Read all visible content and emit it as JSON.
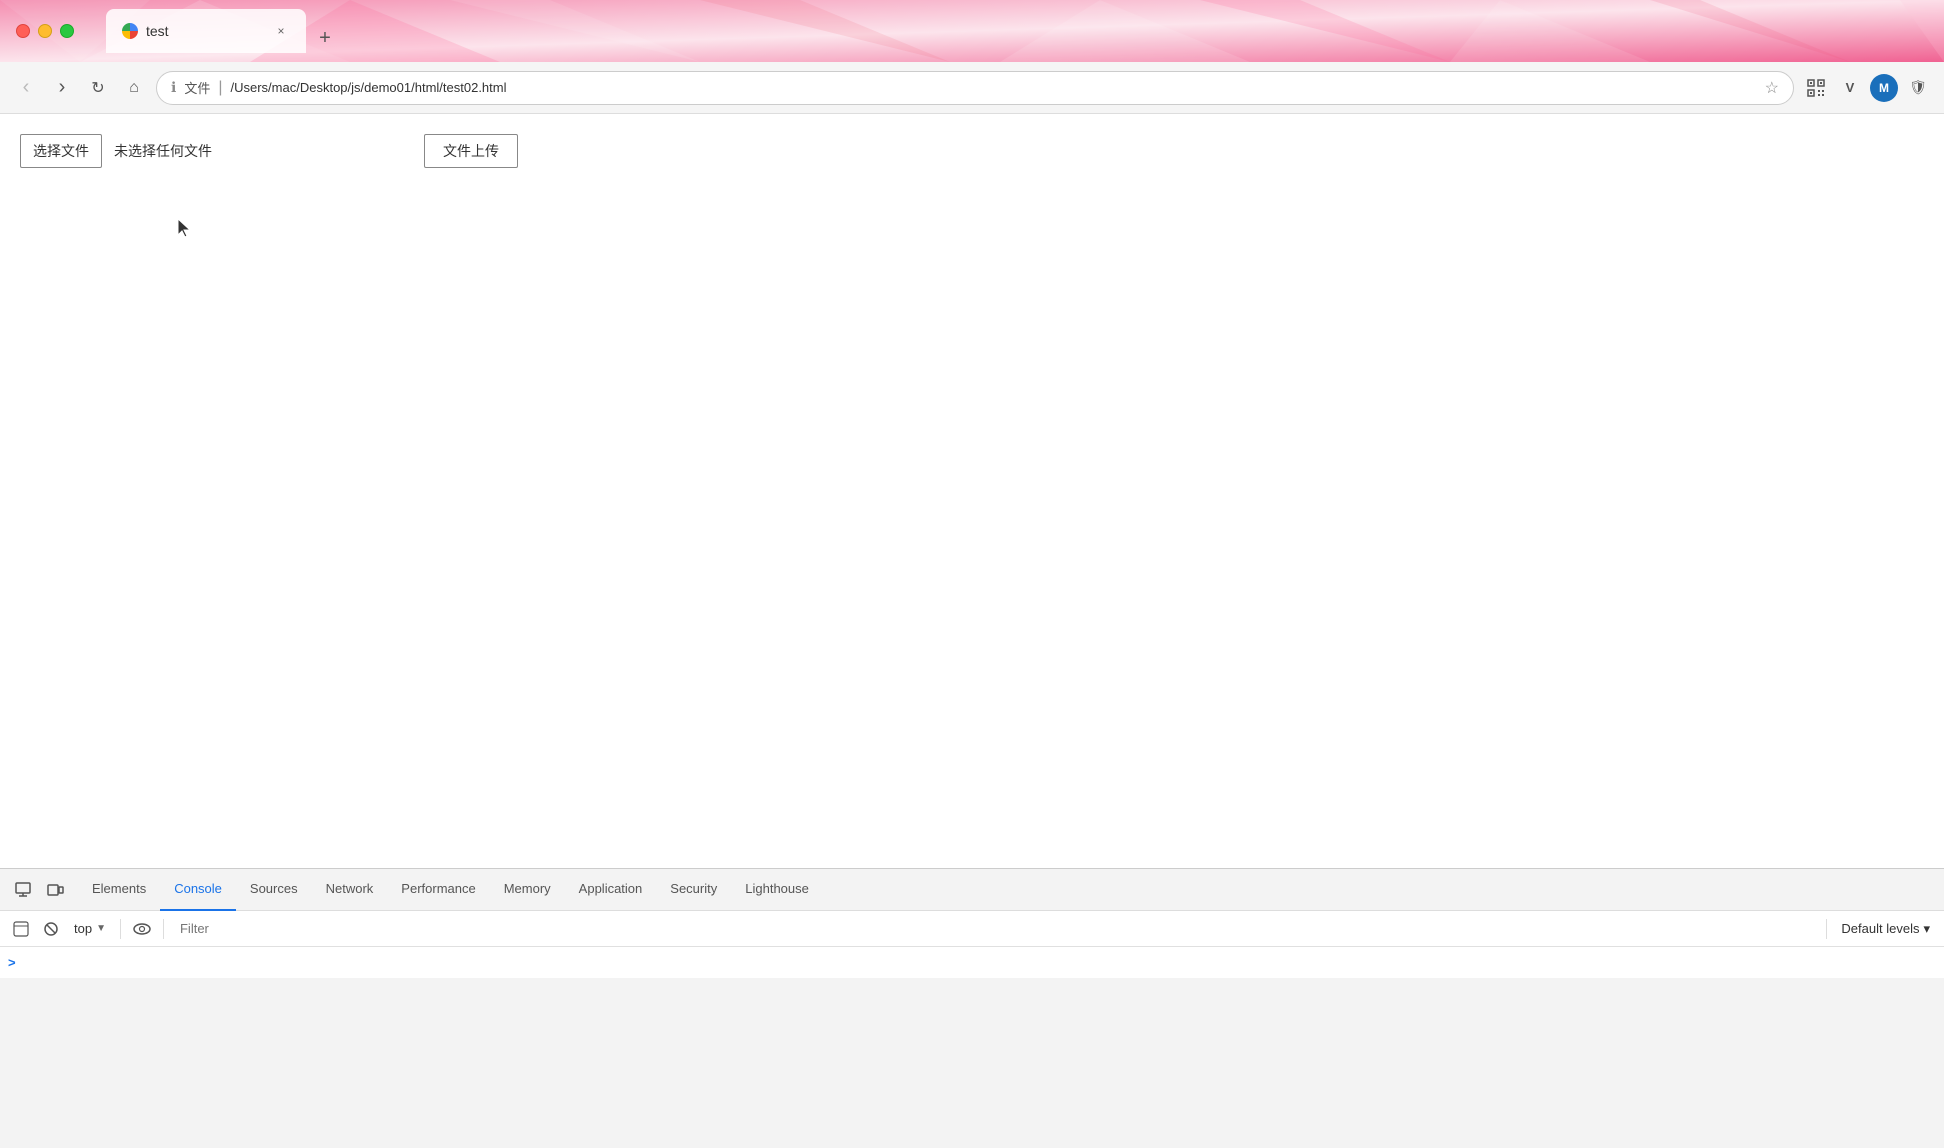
{
  "browser": {
    "traffic_lights": {
      "close_label": "",
      "min_label": "",
      "max_label": ""
    },
    "tab": {
      "title": "test",
      "close_label": "×"
    },
    "new_tab_label": "+",
    "nav": {
      "back_label": "‹",
      "forward_label": "›",
      "reload_label": "↻",
      "home_label": "⌂",
      "info_label": "ℹ",
      "file_label": "文件",
      "separator": "|",
      "url": "/Users/mac/Desktop/js/demo01/html/test02.html",
      "star_label": "☆",
      "qr_label": "▦",
      "extension1_label": "V",
      "extension2_label": "M",
      "extension3_label": "🛡"
    },
    "page": {
      "choose_file_btn": "选择文件",
      "file_status": "未选择任何文件",
      "upload_btn": "文件上传"
    },
    "devtools": {
      "icon1_label": "⬚",
      "icon2_label": "⧉",
      "tabs": [
        {
          "id": "elements",
          "label": "Elements",
          "active": false
        },
        {
          "id": "console",
          "label": "Console",
          "active": true
        },
        {
          "id": "sources",
          "label": "Sources",
          "active": false
        },
        {
          "id": "network",
          "label": "Network",
          "active": false
        },
        {
          "id": "performance",
          "label": "Performance",
          "active": false
        },
        {
          "id": "memory",
          "label": "Memory",
          "active": false
        },
        {
          "id": "application",
          "label": "Application",
          "active": false
        },
        {
          "id": "security",
          "label": "Security",
          "active": false
        },
        {
          "id": "lighthouse",
          "label": "Lighthouse",
          "active": false
        }
      ],
      "console_toolbar": {
        "clear_btn": "🚫",
        "run_btn": "▷",
        "context_label": "top",
        "dropdown_arrow": "▼",
        "eye_label": "◎",
        "filter_placeholder": "Filter",
        "default_levels_label": "Default levels",
        "levels_arrow": "▾"
      },
      "console_content": {
        "prompt_symbol": ">"
      }
    }
  }
}
